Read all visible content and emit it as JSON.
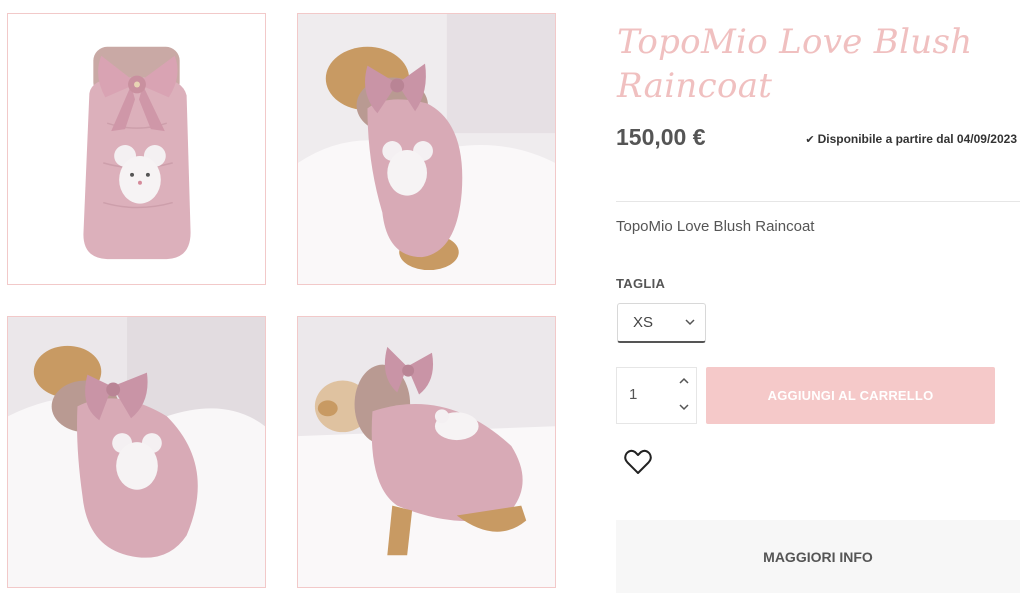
{
  "product": {
    "title": "TopoMio Love Blush Raincoat",
    "price": "150,00 €",
    "availability": "Disponibile a partire dal 04/09/2023",
    "short_description": "TopoMio Love Blush Raincoat"
  },
  "size": {
    "label": "TAGLIA",
    "selected": "XS"
  },
  "quantity": {
    "value": "1"
  },
  "actions": {
    "add_to_cart": "AGGIUNGI AL CARRELLO",
    "more_info": "MAGGIORI INFO"
  },
  "icons": {
    "availability": "check-icon",
    "wishlist": "heart-outline-icon",
    "select": "chevron-down-icon",
    "qty_up": "chevron-up-icon",
    "qty_down": "chevron-down-icon"
  },
  "colors": {
    "title": "#f0c0c0",
    "button": "#f5c9c9",
    "thumb_border": "#f2c9c9",
    "coat_pink": "#d9a9b3"
  }
}
